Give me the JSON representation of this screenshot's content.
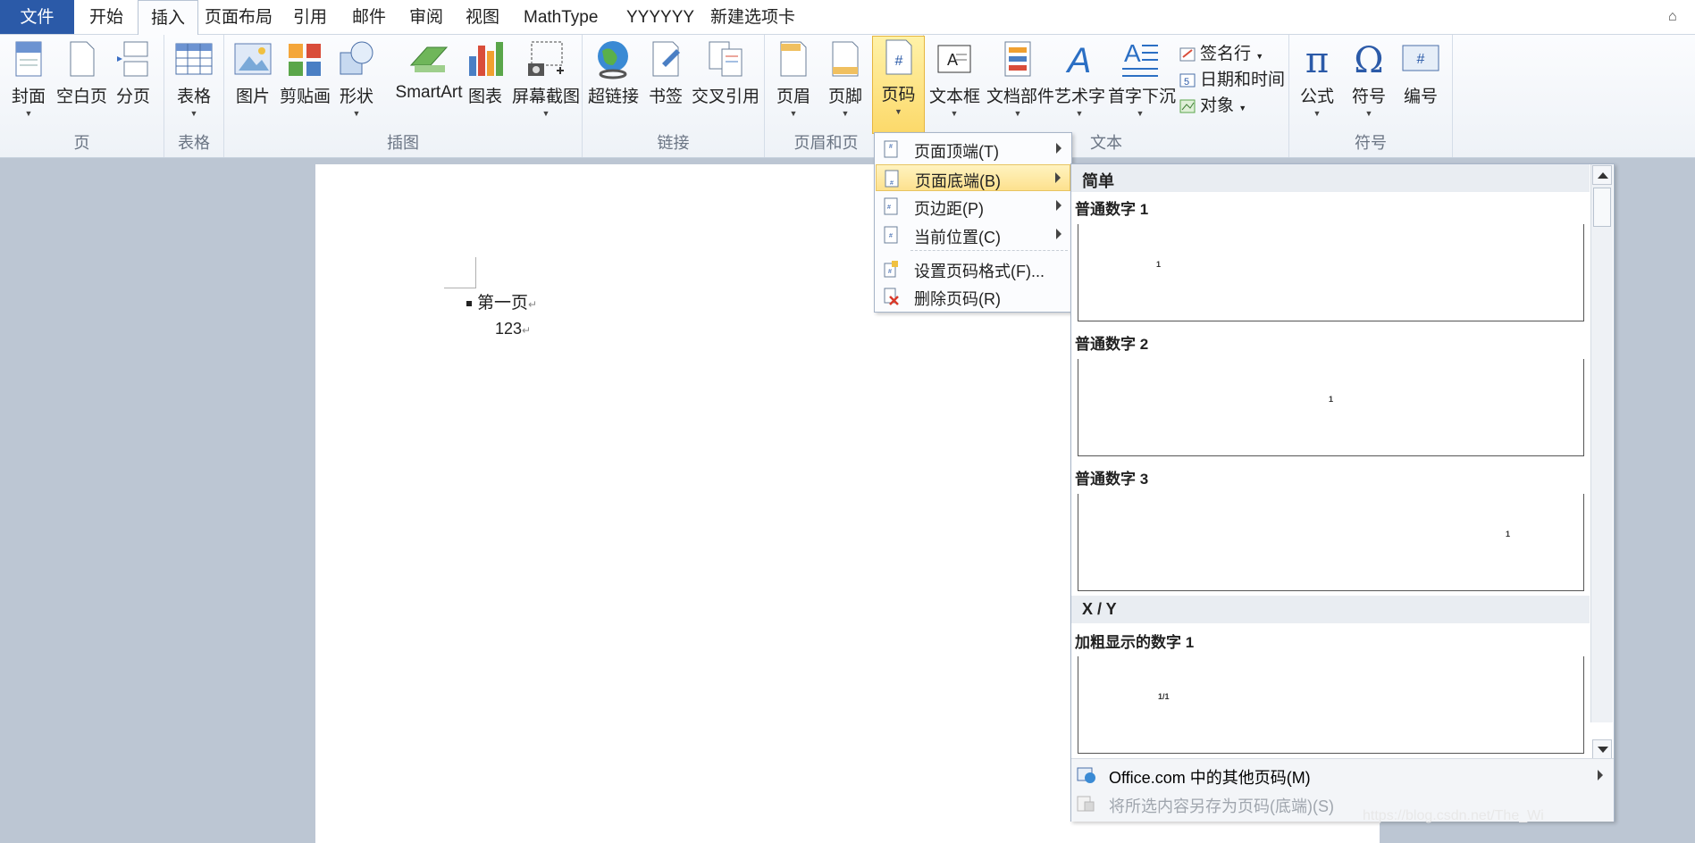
{
  "tabs": {
    "file": "文件",
    "items": [
      "开始",
      "插入",
      "页面布局",
      "引用",
      "邮件",
      "审阅",
      "视图",
      "MathType",
      "YYYYYY",
      "新建选项卡"
    ],
    "active": "插入"
  },
  "ribbon": {
    "groups": {
      "page": "页",
      "table": "表格",
      "illustrations": "插图",
      "links": "链接",
      "header_footer": "页眉和页",
      "text": "文本",
      "symbols": "符号"
    },
    "buttons": {
      "cover": "封面",
      "blank": "空白页",
      "pagebreak": "分页",
      "table": "表格",
      "picture": "图片",
      "clipart": "剪贴画",
      "shapes": "形状",
      "smartart": "SmartArt",
      "chart": "图表",
      "screenshot": "屏幕截图",
      "hyperlink": "超链接",
      "bookmark": "书签",
      "crossref": "交叉引用",
      "header": "页眉",
      "footer": "页脚",
      "pagenum": "页码",
      "textbox": "文本框",
      "quickparts": "文档部件",
      "wordart": "艺术字",
      "dropcap": "首字下沉",
      "signature": "签名行",
      "datetime": "日期和时间",
      "object": "对象",
      "equation": "公式",
      "symbol": "符号",
      "number": "编号"
    }
  },
  "document": {
    "para1": "第一页",
    "para2": "123"
  },
  "page_number_menu": {
    "items": [
      {
        "label": "页面顶端(T)",
        "submenu": true
      },
      {
        "label": "页面底端(B)",
        "submenu": true,
        "highlighted": true
      },
      {
        "label": "页边距(P)",
        "submenu": true
      },
      {
        "label": "当前位置(C)",
        "submenu": true
      },
      {
        "label": "设置页码格式(F)...",
        "submenu": false
      },
      {
        "label": "删除页码(R)",
        "submenu": false
      }
    ]
  },
  "gallery": {
    "categories": [
      "简单",
      "X / Y"
    ],
    "entries": [
      {
        "name": "普通数字 1",
        "preview": "1"
      },
      {
        "name": "普通数字 2",
        "preview": "1"
      },
      {
        "name": "普通数字 3",
        "preview": "1"
      },
      {
        "name": "加粗显示的数字 1",
        "preview": "1/1"
      }
    ],
    "footer": {
      "more": "Office.com 中的其他页码(M)",
      "save": "将所选内容另存为页码(底端)(S)"
    }
  },
  "watermark": "https://blog.csdn.net/The_Wi",
  "colors": {
    "accent": "#2b5aa8",
    "highlight": "#fde18e",
    "workspace": "#bcc6d3"
  }
}
